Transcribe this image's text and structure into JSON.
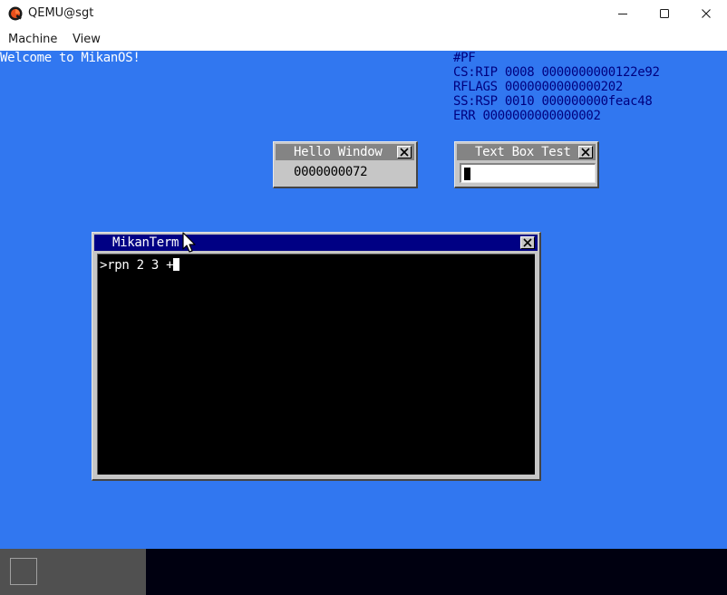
{
  "window": {
    "title": "QEMU@sgt",
    "menu": [
      "Machine",
      "View"
    ]
  },
  "desktop": {
    "welcome": "Welcome to MikanOS!",
    "fault": {
      "lines": [
        "#PF",
        "CS:RIP 0008 0000000000122e92",
        "RFLAGS 0000000000000202",
        "SS:RSP 0010 000000000feac48",
        "ERR 0000000000000002"
      ]
    }
  },
  "hello_window": {
    "title": "Hello Window",
    "counter": "0000000072"
  },
  "textbox_window": {
    "title": "Text Box Test",
    "value": ""
  },
  "terminal": {
    "title": "MikanTerm",
    "line": ">rpn 2 3 +"
  },
  "colors": {
    "desktop": "#3177f0",
    "title_active": "#000084",
    "title_inactive": "#848484",
    "taskbar": "#000010"
  }
}
